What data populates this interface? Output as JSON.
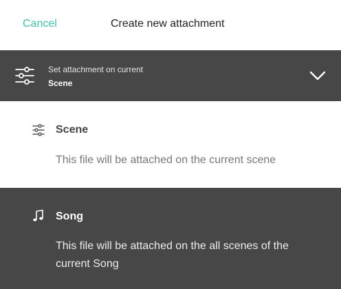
{
  "header": {
    "cancel_label": "Cancel",
    "title": "Create new attachment"
  },
  "selector": {
    "caption": "Set attachment on current",
    "value": "Scene",
    "icon": "sliders-icon",
    "expand_icon": "chevron-down-icon"
  },
  "options": [
    {
      "id": "scene",
      "icon": "sliders-icon",
      "title": "Scene",
      "description": "This file will be attached on the current scene",
      "selected": false
    },
    {
      "id": "song",
      "icon": "music-note-icon",
      "title": "Song",
      "description": "This file will be attached on the all scenes of the current Song",
      "selected": true
    }
  ],
  "colors": {
    "accent": "#3fbfa8",
    "dark_panel": "#474747"
  }
}
